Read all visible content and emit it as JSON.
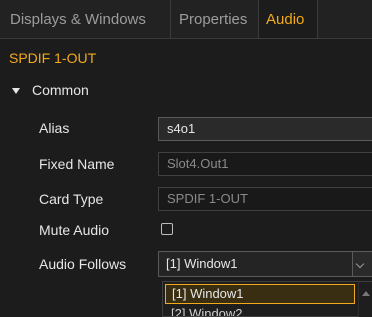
{
  "tabs": [
    {
      "label": "Displays & Windows",
      "active": false
    },
    {
      "label": "Properties",
      "active": false
    },
    {
      "label": "Audio",
      "active": true
    }
  ],
  "section_title": "SPDIF 1-OUT",
  "group": {
    "label": "Common",
    "expanded": true
  },
  "fields": {
    "alias": {
      "label": "Alias",
      "value": "s4o1"
    },
    "fixed_name": {
      "label": "Fixed Name",
      "value": "Slot4.Out1"
    },
    "card_type": {
      "label": "Card Type",
      "value": "SPDIF 1-OUT"
    },
    "mute_audio": {
      "label": "Mute Audio",
      "checked": false
    },
    "audio_follows": {
      "label": "Audio Follows",
      "value": "[1] Window1",
      "options": [
        "[1] Window1",
        "[2] Window2"
      ]
    }
  },
  "colors": {
    "accent": "#f2a91b",
    "background": "#1c1c1c",
    "text": "#e6e6e6",
    "readonly_text": "#8a8a8a"
  }
}
